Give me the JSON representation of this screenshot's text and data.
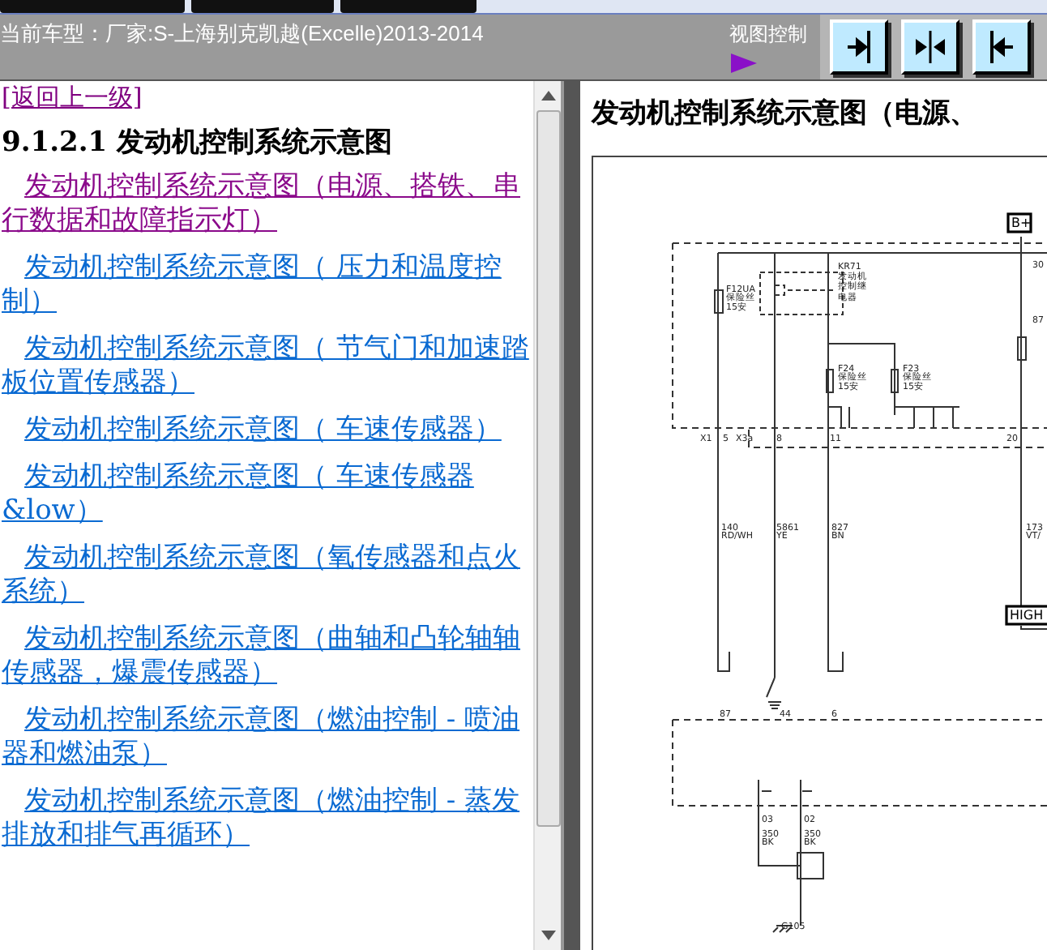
{
  "header": {
    "vehicle": "当前车型：厂家:S-上海别克凯越(Excelle)2013-2014",
    "view_control_label": "视图控制",
    "view_buttons": [
      {
        "kind": "expand-right"
      },
      {
        "kind": "split"
      },
      {
        "kind": "expand-left"
      }
    ]
  },
  "left_pane": {
    "back_link": "[返回上一级]",
    "heading": "9.1.2.1 发动机控制系统示意图",
    "links": [
      {
        "text": "发动机控制系统示意图（电源、搭铁、串行数据和故障指示灯）",
        "visited": true
      },
      {
        "text": "发动机控制系统示意图（ 压力和温度控制）",
        "visited": false
      },
      {
        "text": "发动机控制系统示意图（ 节气门和加速踏板位置传感器）",
        "visited": false
      },
      {
        "text": "发动机控制系统示意图（ 车速传感器）",
        "visited": false
      },
      {
        "text": "发动机控制系统示意图（ 车速传感器&low）",
        "visited": false
      },
      {
        "text": "发动机控制系统示意图（氧传感器和点火系统）",
        "visited": false
      },
      {
        "text": "发动机控制系统示意图（曲轴和凸轮轴轴传感器，爆震传感器）",
        "visited": false
      },
      {
        "text": "发动机控制系统示意图（燃油控制 - 喷油器和燃油泵）",
        "visited": false
      },
      {
        "text": "发动机控制系统示意图（燃油控制 - 蒸发排放和排气再循环）",
        "visited": false
      }
    ]
  },
  "right_pane": {
    "title": "发动机控制系统示意图（电源、",
    "diagram": {
      "labels": [
        {
          "text": "KR71",
          "kind": "label"
        },
        {
          "text": "发动机",
          "kind": "label"
        },
        {
          "text": "控制继",
          "kind": "label"
        },
        {
          "text": "电器",
          "kind": "label"
        },
        {
          "text": "F12UA",
          "kind": "label"
        },
        {
          "text": "保险丝",
          "kind": "label"
        },
        {
          "text": "15安",
          "kind": "label"
        },
        {
          "text": "F24",
          "kind": "label"
        },
        {
          "text": "保险丝",
          "kind": "label"
        },
        {
          "text": "15安",
          "kind": "label"
        },
        {
          "text": "F23",
          "kind": "label"
        },
        {
          "text": "保险丝",
          "kind": "label"
        },
        {
          "text": "15安",
          "kind": "label"
        },
        {
          "text": "X1",
          "kind": "label"
        },
        {
          "text": "5",
          "kind": "label"
        },
        {
          "text": "X3a",
          "kind": "label"
        },
        {
          "text": "8",
          "kind": "label"
        },
        {
          "text": "11",
          "kind": "label"
        },
        {
          "text": "20",
          "kind": "label"
        },
        {
          "text": "140",
          "kind": "label"
        },
        {
          "text": "RD/WH",
          "kind": "label"
        },
        {
          "text": "5861",
          "kind": "label"
        },
        {
          "text": "YE",
          "kind": "label"
        },
        {
          "text": "827",
          "kind": "label"
        },
        {
          "text": "BN",
          "kind": "label"
        },
        {
          "text": "173",
          "kind": "label"
        },
        {
          "text": "VT/",
          "kind": "label"
        },
        {
          "text": "87",
          "kind": "label"
        },
        {
          "text": "44",
          "kind": "label"
        },
        {
          "text": "6",
          "kind": "label"
        },
        {
          "text": "03",
          "kind": "label"
        },
        {
          "text": "02",
          "kind": "label"
        },
        {
          "text": "350",
          "kind": "label"
        },
        {
          "text": "BK",
          "kind": "label"
        },
        {
          "text": "350",
          "kind": "label"
        },
        {
          "text": "BK",
          "kind": "label"
        },
        {
          "text": "G105",
          "kind": "label"
        },
        {
          "text": "30",
          "kind": "label"
        },
        {
          "text": "87",
          "kind": "label"
        },
        {
          "text": "B+",
          "kind": "terminal"
        },
        {
          "text": "HIGH",
          "kind": "terminal"
        }
      ]
    }
  }
}
